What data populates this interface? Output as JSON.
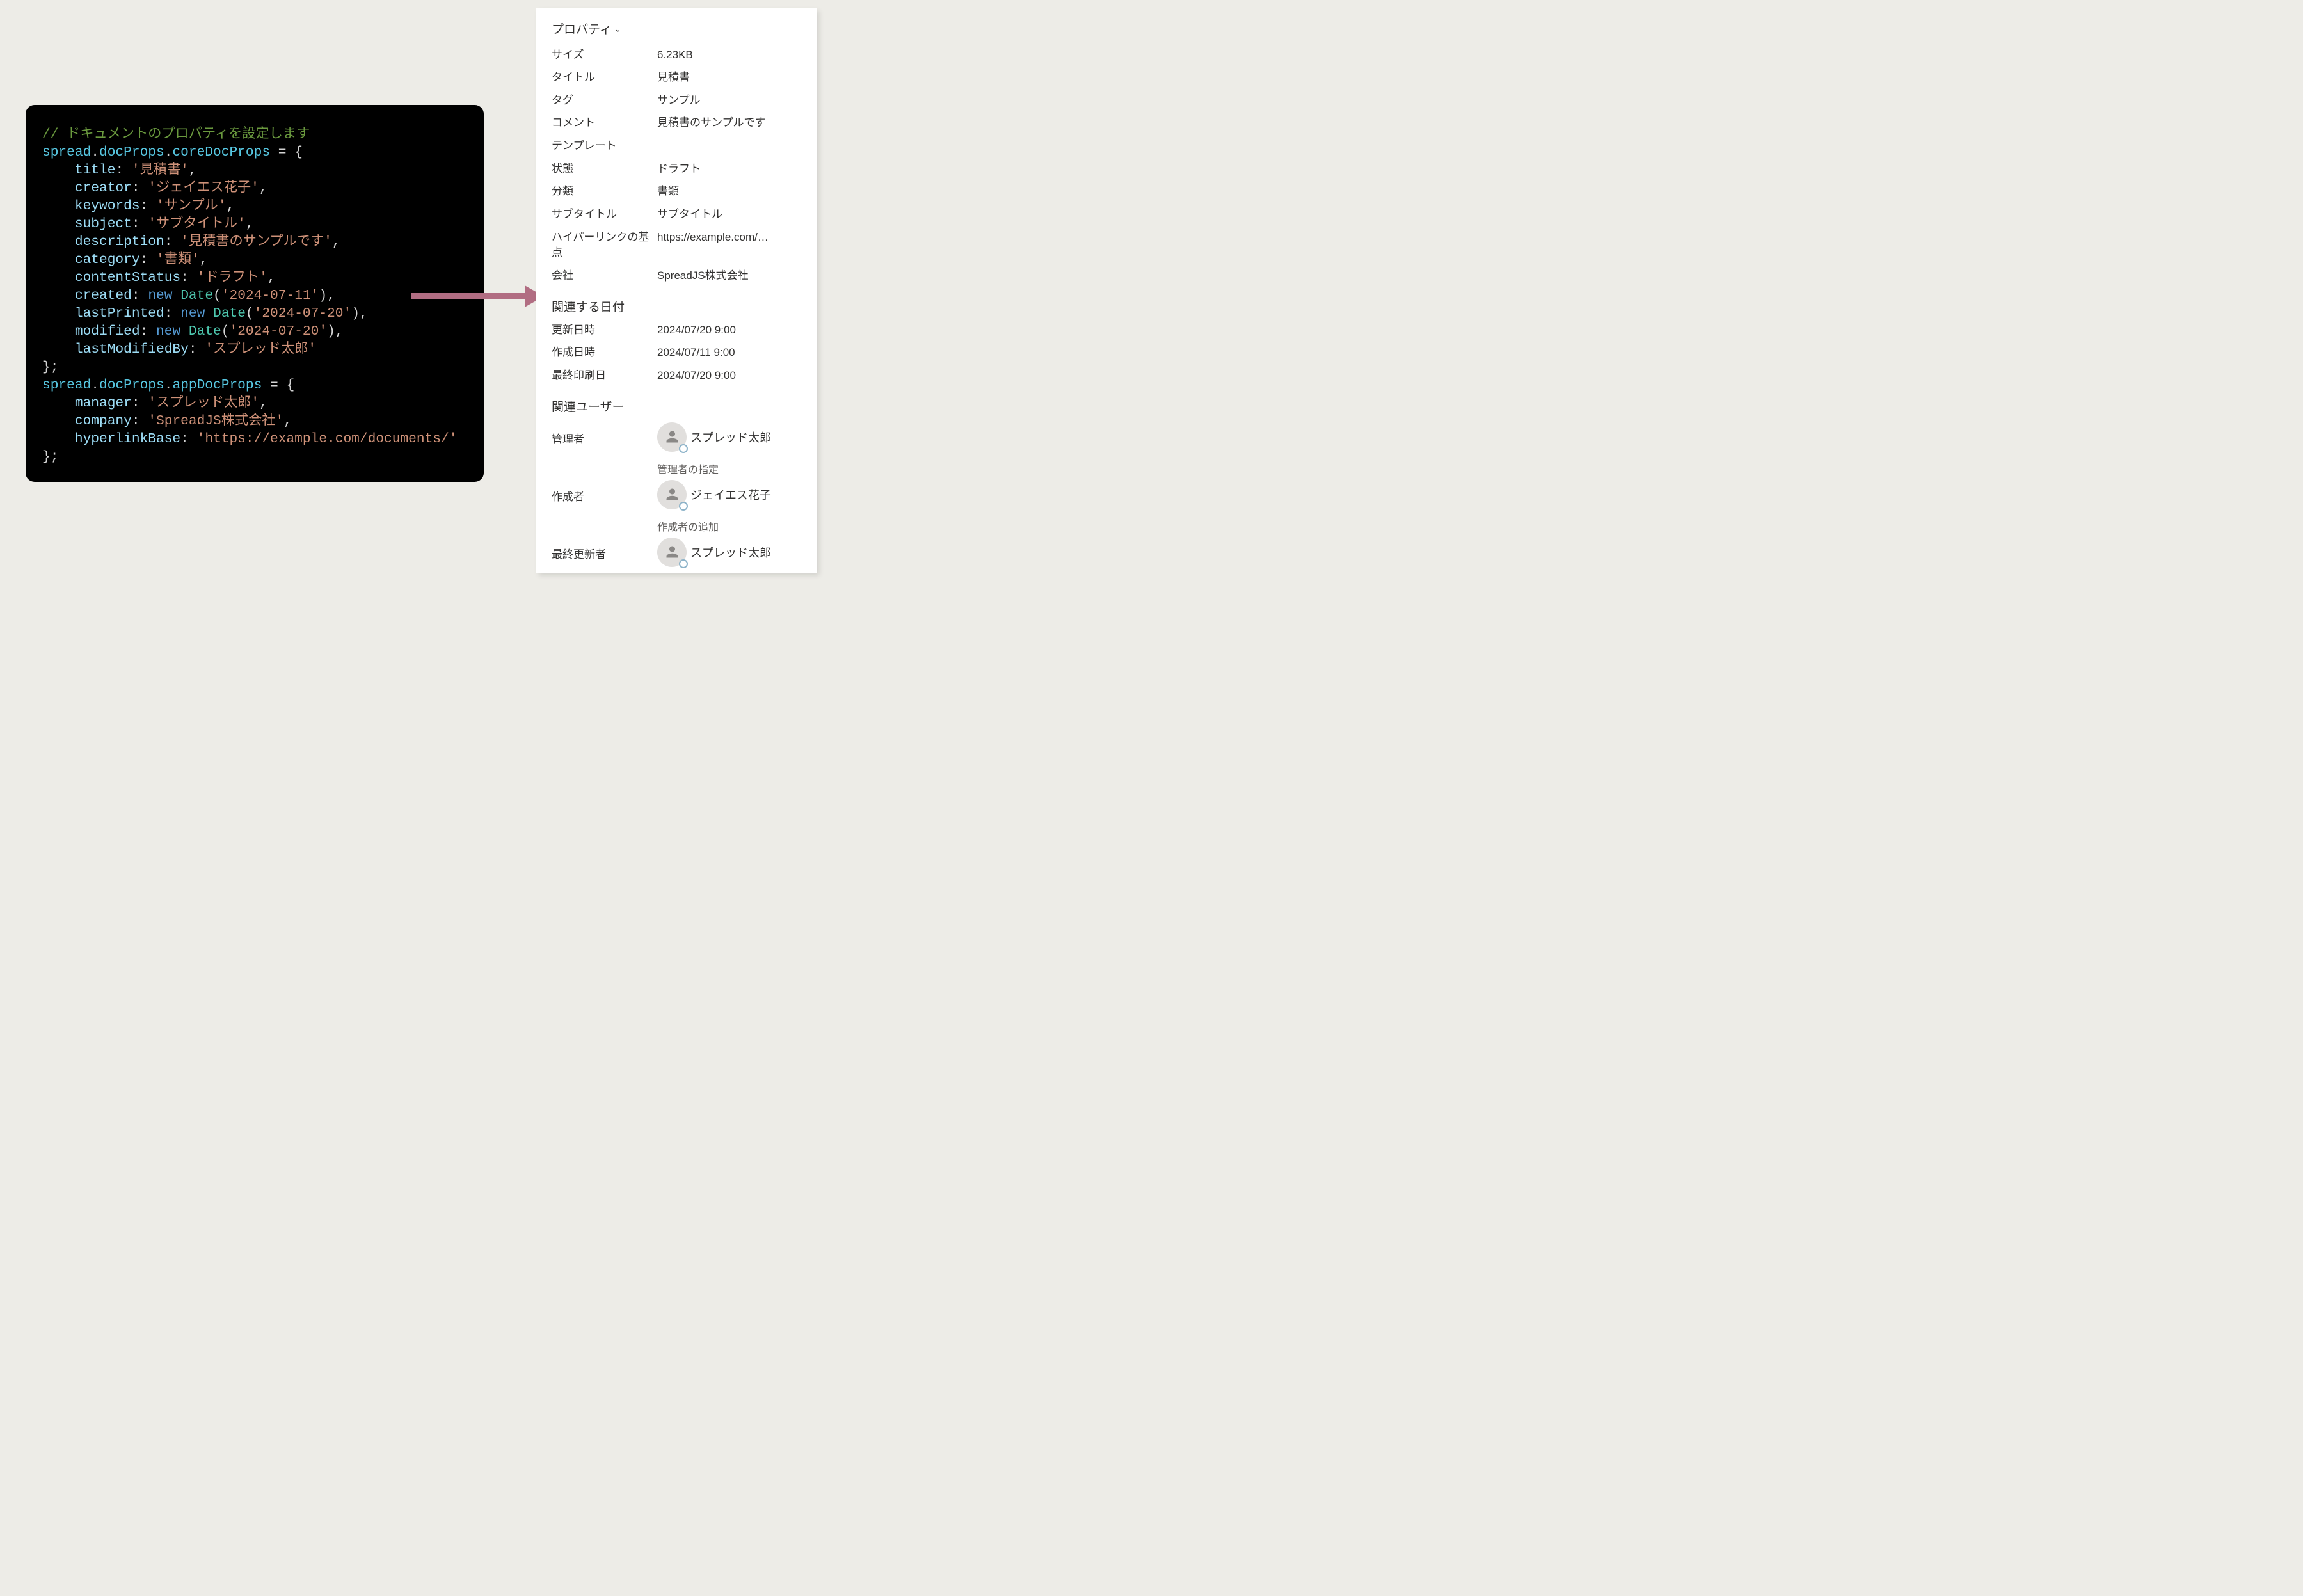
{
  "code": {
    "comment": "// ドキュメントのプロパティを設定します",
    "spread": "spread",
    "docProps": "docProps",
    "coreDocProps": "coreDocProps",
    "appDocProps": "appDocProps",
    "eq_open": " = {",
    "close": "};",
    "comma": ",",
    "colon": ": ",
    "newkw": "new",
    "datecls": "Date",
    "lparen_q": "(",
    "rparen": ")",
    "q": "'",
    "core": {
      "title_k": "title",
      "title_v": "見積書",
      "creator_k": "creator",
      "creator_v": "ジェイエス花子",
      "keywords_k": "keywords",
      "keywords_v": "サンプル",
      "subject_k": "subject",
      "subject_v": "サブタイトル",
      "description_k": "description",
      "description_v": "見積書のサンプルです",
      "category_k": "category",
      "category_v": "書類",
      "contentStatus_k": "contentStatus",
      "contentStatus_v": "ドラフト",
      "created_k": "created",
      "created_v": "2024-07-11",
      "lastPrinted_k": "lastPrinted",
      "lastPrinted_v": "2024-07-20",
      "modified_k": "modified",
      "modified_v": "2024-07-20",
      "lastModifiedBy_k": "lastModifiedBy",
      "lastModifiedBy_v": "スプレッド太郎"
    },
    "app": {
      "manager_k": "manager",
      "manager_v": "スプレッド太郎",
      "company_k": "company",
      "company_v": "SpreadJS株式会社",
      "hyperlinkBase_k": "hyperlinkBase",
      "hyperlinkBase_v": "https://example.com/documents/"
    }
  },
  "panel": {
    "header": "プロパティ",
    "props": {
      "size_k": "サイズ",
      "size_v": "6.23KB",
      "title_k": "タイトル",
      "title_v": "見積書",
      "tag_k": "タグ",
      "tag_v": "サンプル",
      "comment_k": "コメント",
      "comment_v": "見積書のサンプルです",
      "template_k": "テンプレート",
      "template_v": "",
      "status_k": "状態",
      "status_v": "ドラフト",
      "category_k": "分類",
      "category_v": "書類",
      "subtitle_k": "サブタイトル",
      "subtitle_v": "サブタイトル",
      "hyperlink_k": "ハイパーリンクの基点",
      "hyperlink_v": "https://example.com/…",
      "company_k": "会社",
      "company_v": "SpreadJS株式会社"
    },
    "dates": {
      "header": "関連する日付",
      "modified_k": "更新日時",
      "modified_v": "2024/07/20 9:00",
      "created_k": "作成日時",
      "created_v": "2024/07/11 9:00",
      "printed_k": "最終印刷日",
      "printed_v": "2024/07/20 9:00"
    },
    "users": {
      "header": "関連ユーザー",
      "manager_k": "管理者",
      "manager_name": "スプレッド太郎",
      "manager_sub": "管理者の指定",
      "creator_k": "作成者",
      "creator_name": "ジェイエス花子",
      "creator_sub": "作成者の追加",
      "lastmod_k": "最終更新者",
      "lastmod_name": "スプレッド太郎"
    }
  }
}
